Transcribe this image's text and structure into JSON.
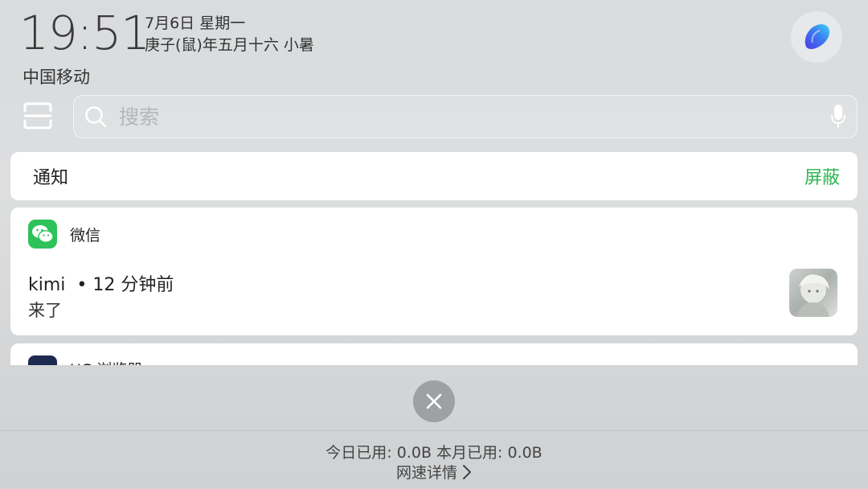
{
  "status": {
    "time": "19:51",
    "date": "7月6日 星期一",
    "lunar": "庚子(鼠)年五月十六 小暑",
    "carrier": "中国移动"
  },
  "search": {
    "placeholder": "搜索"
  },
  "notifications": {
    "title": "通知",
    "mute_label": "屏蔽",
    "items": [
      {
        "app": "微信",
        "sender": "kimi",
        "time_ago": "12 分钟前",
        "message": "来了"
      },
      {
        "app": "UC 浏览器"
      }
    ]
  },
  "footer": {
    "usage": "今日已用: 0.0B 本月已用: 0.0B",
    "net_detail": "网速详情"
  },
  "colors": {
    "accent_green": "#2fb450",
    "wechat_green": "#2dc25a"
  },
  "icons": [
    "assistant-icon",
    "scan-icon",
    "search-icon",
    "microphone-icon",
    "wechat-icon",
    "close-icon",
    "chevron-right-icon"
  ]
}
